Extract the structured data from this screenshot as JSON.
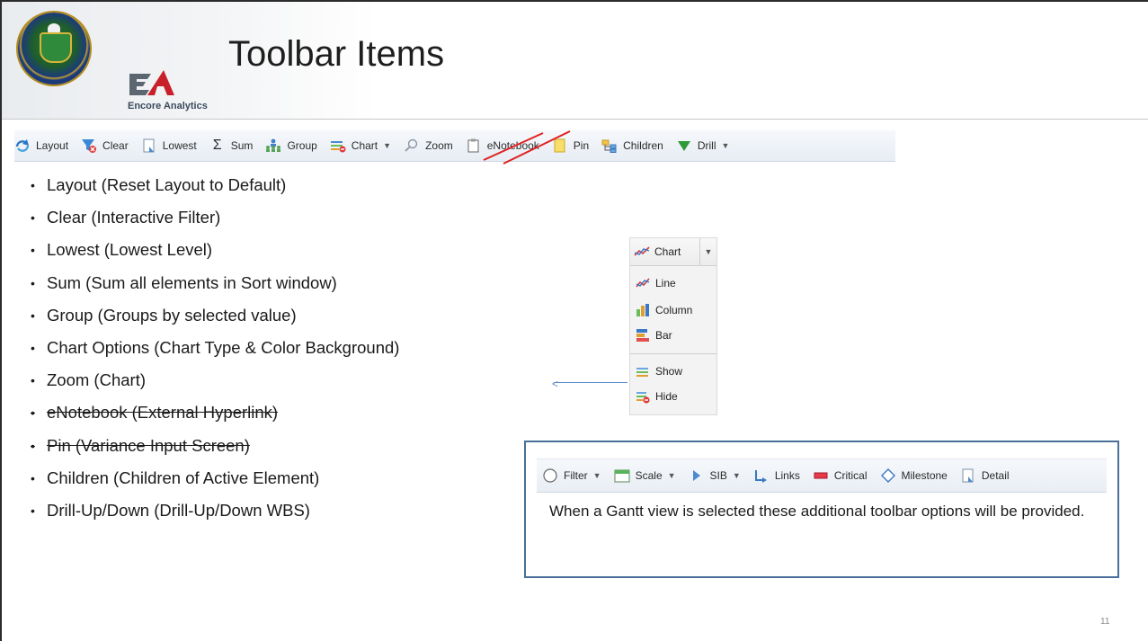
{
  "slide": {
    "title": "Toolbar Items",
    "brand": "Encore Analytics",
    "page_number": "11"
  },
  "toolbar": {
    "items": [
      {
        "label": "Layout",
        "icon": "refresh-icon"
      },
      {
        "label": "Clear",
        "icon": "clear-filter-icon"
      },
      {
        "label": "Lowest",
        "icon": "document-icon"
      },
      {
        "label": "Sum",
        "icon": "sigma-icon"
      },
      {
        "label": "Group",
        "icon": "group-icon"
      },
      {
        "label": "Chart",
        "icon": "chart-hide-icon",
        "dropdown": true
      },
      {
        "label": "Zoom",
        "icon": "magnifier-icon"
      },
      {
        "label": "eNotebook",
        "icon": "clipboard-icon",
        "struck": true
      },
      {
        "label": "Pin",
        "icon": "pin-note-icon",
        "struck": true
      },
      {
        "label": "Children",
        "icon": "children-icon"
      },
      {
        "label": "Drill",
        "icon": "drill-down-icon",
        "dropdown": true
      }
    ]
  },
  "bullets": [
    {
      "text": "Layout (Reset Layout to Default)",
      "struck": false
    },
    {
      "text": "Clear (Interactive Filter)",
      "struck": false
    },
    {
      "text": "Lowest (Lowest Level)",
      "struck": false
    },
    {
      "text": "Sum (Sum all elements in Sort window)",
      "struck": false
    },
    {
      "text": "Group (Groups by selected value)",
      "struck": false
    },
    {
      "text": "Chart Options (Chart Type & Color Background)",
      "struck": false
    },
    {
      "text": "Zoom (Chart)",
      "struck": false
    },
    {
      "text": "eNotebook (External Hyperlink)",
      "struck": true
    },
    {
      "text": "Pin (Variance Input Screen)",
      "struck": true
    },
    {
      "text": "Children (Children of Active Element)",
      "struck": false
    },
    {
      "text": "Drill-Up/Down (Drill-Up/Down WBS)",
      "struck": false
    }
  ],
  "chart_menu": {
    "header": "Chart",
    "items": [
      "Line",
      "Column",
      "Bar",
      "Show",
      "Hide"
    ]
  },
  "gantt": {
    "toolbar": [
      "Filter",
      "Scale",
      "SIB",
      "Links",
      "Critical",
      "Milestone",
      "Detail"
    ],
    "description": "When a Gantt view is selected these additional toolbar options will be provided."
  },
  "colors": {
    "accent_red": "#e02020",
    "border_blue": "#4a6f99",
    "arrow_blue": "#5b8bd0"
  }
}
